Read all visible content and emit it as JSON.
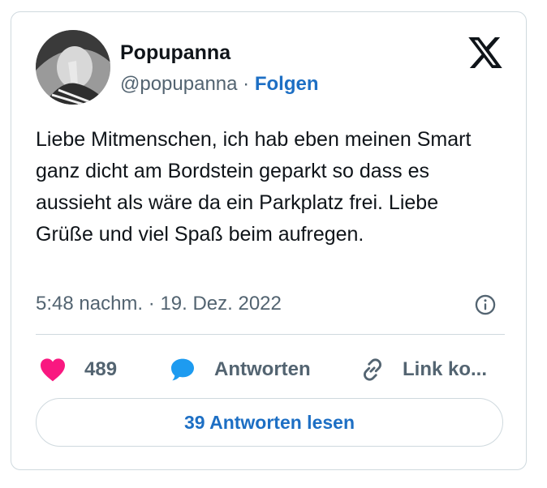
{
  "author": {
    "display_name": "Popupanna",
    "handle": "@popupanna",
    "separator": "·",
    "follow_label": "Folgen"
  },
  "tweet": {
    "text": "Liebe Mitmenschen, ich hab eben meinen Smart ganz dicht am Bordstein geparkt so dass es aussieht als wäre da ein Parkplatz frei. Liebe Grüße und viel Spaß beim aufregen.",
    "time": "5:48 nachm.",
    "meta_separator": "·",
    "date": "19. Dez. 2022"
  },
  "actions": {
    "like_count": "489",
    "reply_label": "Antworten",
    "copy_link_label": "Link ko..."
  },
  "read_replies_label": "39 Antworten lesen",
  "icons": {
    "platform_logo": "x-logo-icon",
    "info": "info-icon",
    "like": "heart-icon",
    "reply": "speech-bubble-icon",
    "link": "link-icon"
  },
  "colors": {
    "accent_blue": "#1d6fc4",
    "heart_pink": "#f91880",
    "reply_blue": "#1d9bf0",
    "muted_text": "#536471",
    "border": "#cfd9de"
  }
}
